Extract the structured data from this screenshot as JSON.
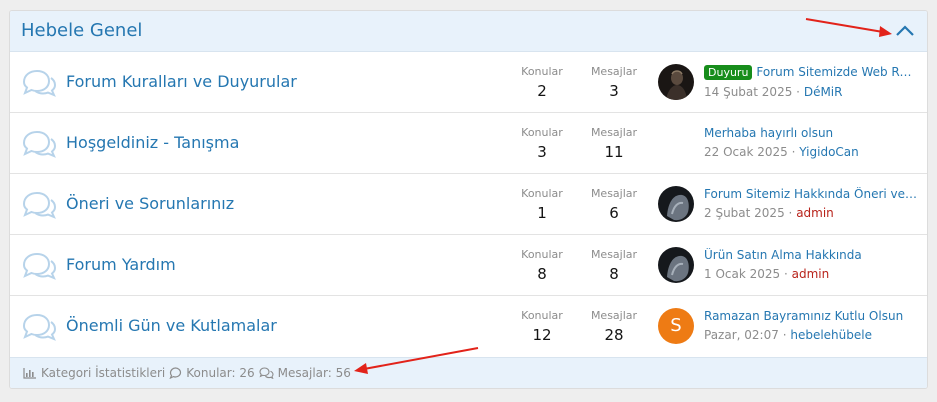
{
  "category": {
    "title": "Hebele Genel",
    "collapse_icon": "chevron-up-icon"
  },
  "forums": [
    {
      "title": "Forum Kuralları ve Duyurular",
      "konular_label": "Konular",
      "konular": "2",
      "mesajlar_label": "Mesajlar",
      "mesajlar": "3",
      "avatar": "photo-dark",
      "last_prefix": "Duyuru",
      "last_title": "Forum Sitemizde Web Rad…",
      "last_date": "14 Şubat 2025",
      "sep": "·",
      "last_user": "DéMiR"
    },
    {
      "title": "Hoşgeldiniz - Tanışma",
      "konular_label": "Konular",
      "konular": "3",
      "mesajlar_label": "Mesajlar",
      "mesajlar": "11",
      "last_title": "Merhaba hayırlı olsun",
      "last_date": "22 Ocak 2025",
      "sep": "·",
      "last_user": "YigidoCan"
    },
    {
      "title": "Öneri ve Sorunlarınız",
      "konular_label": "Konular",
      "konular": "1",
      "mesajlar_label": "Mesajlar",
      "mesajlar": "6",
      "avatar": "photo-grey",
      "last_title": "Forum Sitemiz Hakkında Öneri ve S…",
      "last_date": "2 Şubat 2025",
      "sep": "·",
      "last_user": "admin"
    },
    {
      "title": "Forum Yardım",
      "konular_label": "Konular",
      "konular": "8",
      "mesajlar_label": "Mesajlar",
      "mesajlar": "8",
      "avatar": "photo-grey",
      "last_title": "Ürün Satın Alma Hakkında",
      "last_date": "1 Ocak 2025",
      "sep": "·",
      "last_user": "admin"
    },
    {
      "title": "Önemli Gün ve Kutlamalar",
      "konular_label": "Konular",
      "konular": "12",
      "mesajlar_label": "Mesajlar",
      "mesajlar": "28",
      "avatar_letter": "S",
      "last_title": "Ramazan Bayramınız Kutlu Olsun",
      "last_date": "Pazar, 02:07",
      "sep": "·",
      "last_user": "hebelehübele"
    }
  ],
  "footer": {
    "stats_label": "Kategori İstatistikleri",
    "konular": "Konular: 26",
    "mesajlar": "Mesajlar: 56"
  },
  "colors": {
    "link": "#2577b1",
    "staff": "#b8231b",
    "prefix_bg": "#178d1b",
    "header_bg": "#e8f2fb",
    "annotation_arrow": "#e2231a"
  }
}
